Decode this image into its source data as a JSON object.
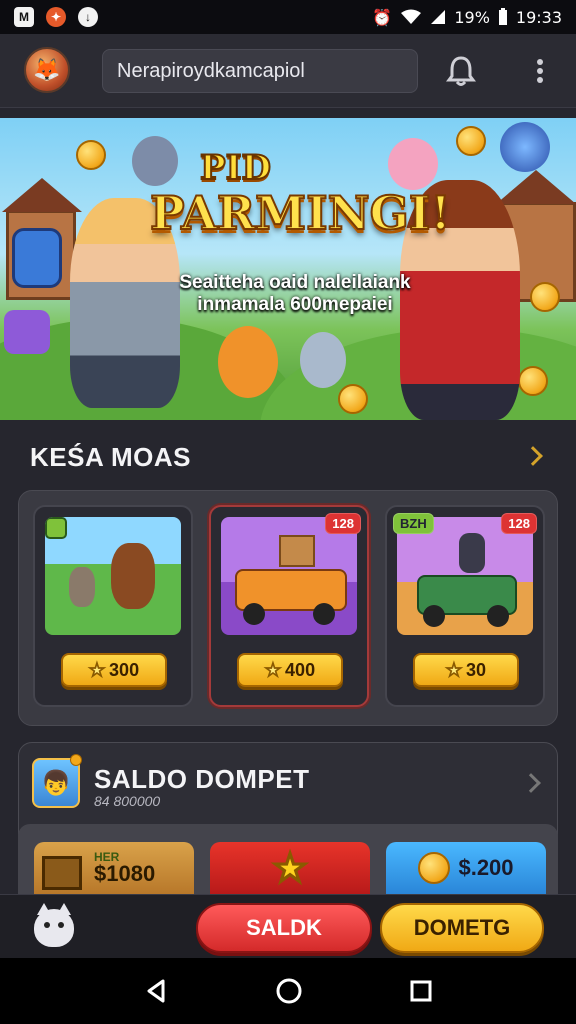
{
  "status_bar": {
    "battery": "19%",
    "time": "19:33",
    "icons": [
      "gmail-icon",
      "app-notification-icon",
      "download-icon",
      "alarm-icon",
      "wifi-icon",
      "signal-icon",
      "battery-icon"
    ]
  },
  "header": {
    "search_text": "Nerapiroydkamcapiol",
    "logo_icon": "fox-avatar-icon",
    "bell_icon": "bell-icon",
    "menu_icon": "more-vert-icon"
  },
  "banner": {
    "pre_title": "PID",
    "title": "PARMINGI!",
    "subtitle_line1": "Seaitteha oaid naleilaiank",
    "subtitle_line2": "inmamala 600mepaiei"
  },
  "featured": {
    "title": "KEŚA MOAS",
    "cards": [
      {
        "badge": "",
        "price": "300",
        "art": "forest-critters"
      },
      {
        "badge": "128",
        "price": "400",
        "art": "yellow-car"
      },
      {
        "badge": "128",
        "price": "30",
        "art": "green-jeep",
        "badge_left": "BZH"
      }
    ]
  },
  "wallet": {
    "title": "SALDO DOMPET",
    "subtitle": "84 800000",
    "tiles": [
      {
        "label": "HER",
        "value": "$1080"
      },
      {
        "label": "",
        "value": ""
      },
      {
        "label": "",
        "value": "$.200"
      }
    ]
  },
  "actions": {
    "primary": "SALDK",
    "secondary": "DOMETG"
  },
  "colors": {
    "bg": "#26262e",
    "accent_gold": "#f0a915",
    "accent_red": "#d42a2a"
  }
}
